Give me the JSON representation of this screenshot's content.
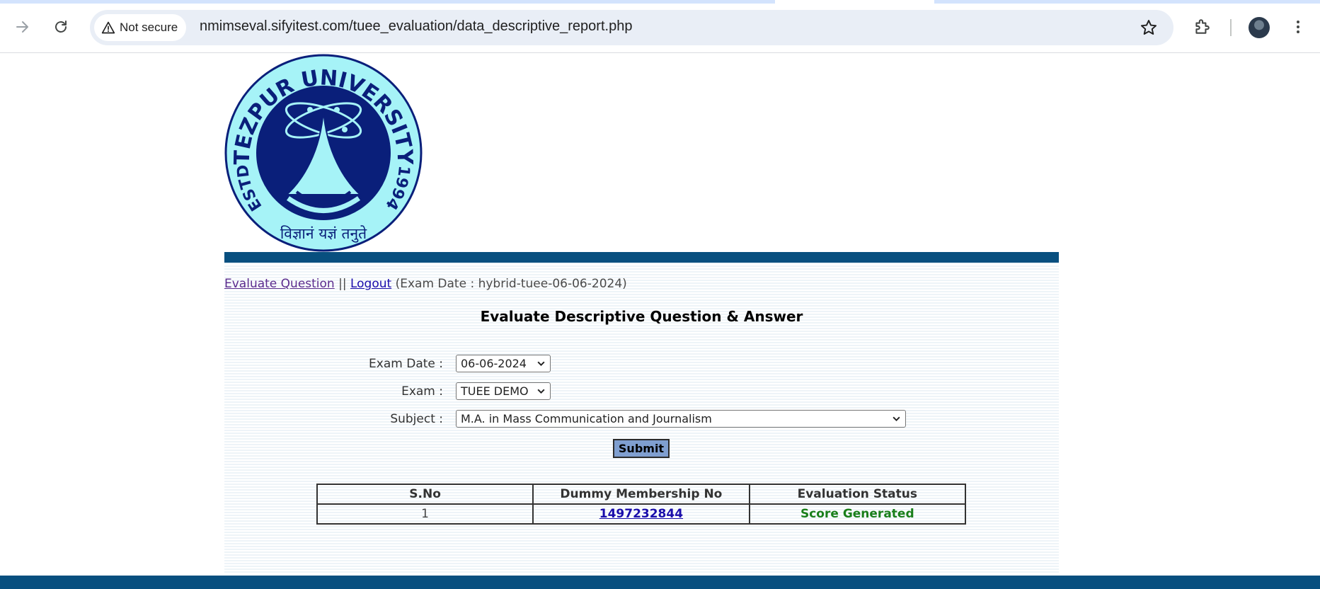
{
  "browser": {
    "security_label": "Not secure",
    "url": "nmimseval.sifyitest.com/tuee_evaluation/data_descriptive_report.php",
    "icons": [
      "forward-icon",
      "reload-icon",
      "warning-icon",
      "star-icon",
      "extensions-icon",
      "profile-avatar",
      "more-menu-icon"
    ]
  },
  "logo": {
    "top_text": "TEZPUR UNIVERSITY",
    "left_text": "ESTD",
    "right_text": "1994",
    "motto": "विज्ञानं यज्ञं तनुते"
  },
  "nav": {
    "evaluate_link": "Evaluate Question",
    "separator": "||",
    "logout_link": "Logout",
    "exam_date_info": "(Exam Date : hybrid-tuee-06-06-2024)"
  },
  "heading": "Evaluate Descriptive Question & Answer",
  "form": {
    "exam_date_label": "Exam Date :",
    "exam_date_value": "06-06-2024",
    "exam_label": "Exam :",
    "exam_value": "TUEE DEMO",
    "subject_label": "Subject :",
    "subject_value": "M.A. in Mass Communication and Journalism",
    "submit_label": "Submit"
  },
  "table": {
    "headers": [
      "S.No",
      "Dummy Membership No",
      "Evaluation Status"
    ],
    "rows": [
      {
        "sno": "1",
        "membership_no": "1497232844",
        "status": "Score Generated"
      }
    ]
  },
  "colors": {
    "brand_bar": "#084f7f",
    "status_green": "#1a7f1a",
    "submit_bg": "#7f9fd0",
    "logo_dark": "#0a1f7a",
    "logo_light": "#a6f3f7"
  }
}
